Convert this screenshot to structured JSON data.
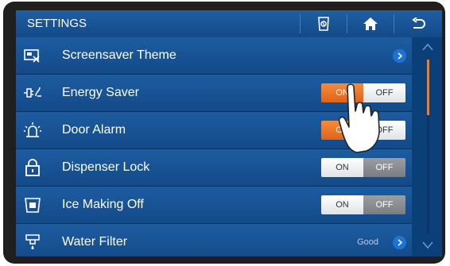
{
  "header": {
    "title": "SETTINGS",
    "buttons": [
      "refrigerator-settings-icon",
      "home-icon",
      "back-icon"
    ]
  },
  "rows": [
    {
      "icon": "screensaver-icon",
      "label": "Screensaver Theme",
      "control": "chevron"
    },
    {
      "icon": "energy-saver-icon",
      "label": "Energy Saver",
      "control": "toggle",
      "on": "ON",
      "off": "OFF",
      "state": "on"
    },
    {
      "icon": "alarm-icon",
      "label": "Door Alarm",
      "control": "toggle",
      "on": "ON",
      "off": "OFF",
      "state": "on"
    },
    {
      "icon": "lock-icon",
      "label": "Dispenser Lock",
      "control": "toggle",
      "on": "ON",
      "off": "OFF",
      "state": "off"
    },
    {
      "icon": "ice-off-icon",
      "label": "Ice Making Off",
      "control": "toggle",
      "on": "ON",
      "off": "OFF",
      "state": "off"
    },
    {
      "icon": "water-filter-icon",
      "label": "Water Filter",
      "control": "chevron",
      "status": "Good"
    }
  ],
  "colors": {
    "accent": "#f47b20",
    "header": "#1a57a0",
    "background": "#0a3f78"
  }
}
